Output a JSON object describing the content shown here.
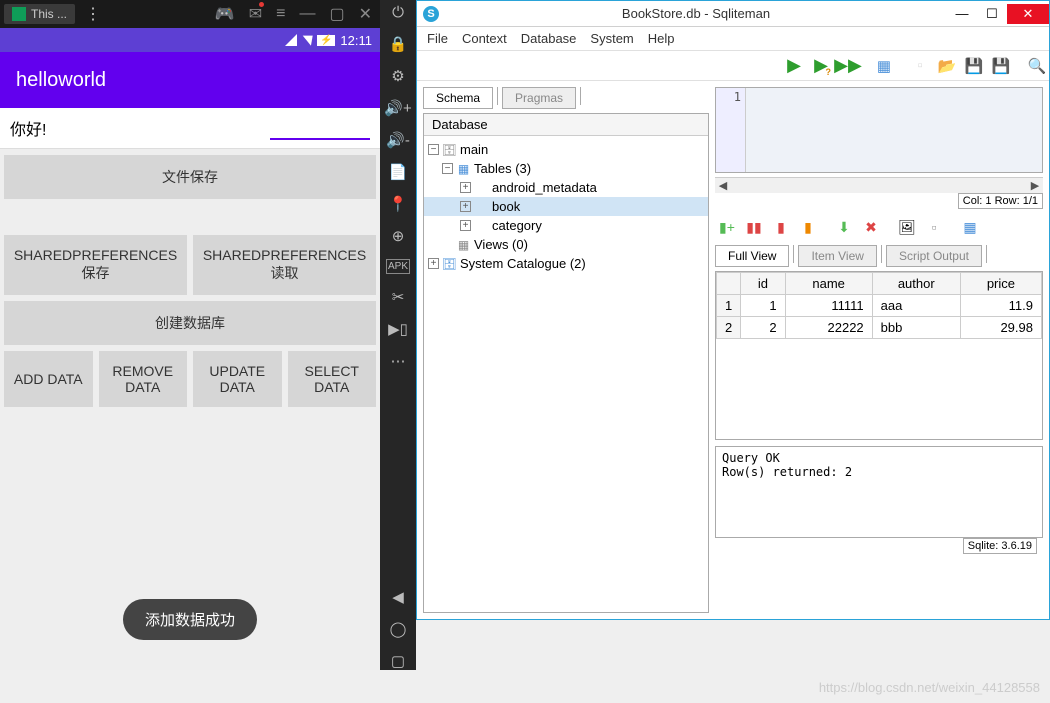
{
  "android": {
    "tab_label": "This ...",
    "status_time": "12:11",
    "app_title": "helloworld",
    "input_text": "你好!",
    "buttons": {
      "file_save": "文件保存",
      "sp_save": "SHAREDPREFERENCES保存",
      "sp_read": "SHAREDPREFERENCES读取",
      "create_db": "创建数据库",
      "add": "ADD DATA",
      "remove": "REMOVE DATA",
      "update": "UPDATE DATA",
      "select": "SELECT DATA"
    },
    "toast": "添加数据成功"
  },
  "sqliteman": {
    "title": "BookStore.db - Sqliteman",
    "menus": {
      "file": "File",
      "context": "Context",
      "database": "Database",
      "system": "System",
      "help": "Help"
    },
    "tabs_left": {
      "schema": "Schema",
      "pragmas": "Pragmas"
    },
    "tree": {
      "header": "Database",
      "main": "main",
      "tables": "Tables (3)",
      "t1": "android_metadata",
      "t2": "book",
      "t3": "category",
      "views": "Views (0)",
      "syscat": "System Catalogue (2)"
    },
    "sql_line": "1",
    "colrow": "Col: 1 Row: 1/1",
    "data_tabs": {
      "full": "Full View",
      "item": "Item View",
      "script": "Script Output"
    },
    "grid": {
      "headers": {
        "id": "id",
        "name": "name",
        "author": "author",
        "price": "price"
      },
      "rows": [
        {
          "n": "1",
          "id": "1",
          "name": "11111",
          "author": "aaa",
          "price": "11.9"
        },
        {
          "n": "2",
          "id": "2",
          "name": "22222",
          "author": "bbb",
          "price": "29.98"
        }
      ]
    },
    "output": "Query OK\nRow(s) returned: 2",
    "footer": "Sqlite: 3.6.19"
  },
  "watermark": "https://blog.csdn.net/weixin_44128558"
}
